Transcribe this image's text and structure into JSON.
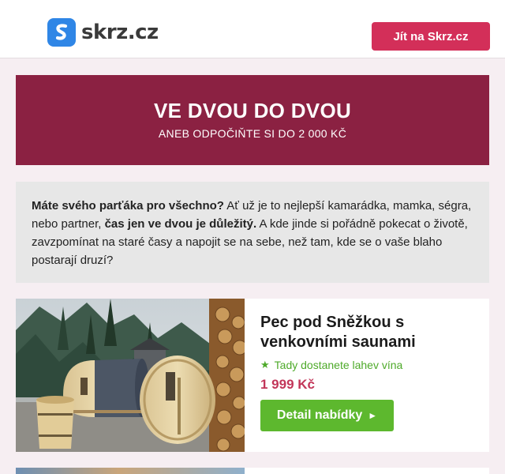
{
  "header": {
    "logo_text": "skrz.cz",
    "cta_label": "Jít na Skrz.cz",
    "accent_color": "#d32f59",
    "logo_icon": "skrz-logo-icon"
  },
  "banner": {
    "title": "VE DVOU DO DVOU",
    "subtitle": "ANEB ODPOČIŇTE SI DO 2 000 KČ",
    "color": "#8b2142"
  },
  "intro": {
    "bold_lead": "Máte svého parťáka pro všechno?",
    "text_1": " Ať už je to nejlepší kamarádka, mamka, ségra, nebo partner, ",
    "bold_mid": "čas jen ve dvou je důležitý.",
    "text_2": " A kde jinde si pořádně pokecat o životě, zavzpomínat na staré časy a napojit se na sebe, než tam, kde se o vaše blaho postarají druzí?"
  },
  "offer": {
    "title": "Pec pod Sněžkou s venkovními saunami",
    "perk_icon": "star-icon",
    "perk": "Tady dostanete lahev vína",
    "price": "1 999 Kč",
    "button_label": "Detail nabídky",
    "button_icon": "play-arrow-icon",
    "image_alt": "barrel-sauna-photo",
    "price_color": "#c23659",
    "button_color": "#5db82e"
  }
}
